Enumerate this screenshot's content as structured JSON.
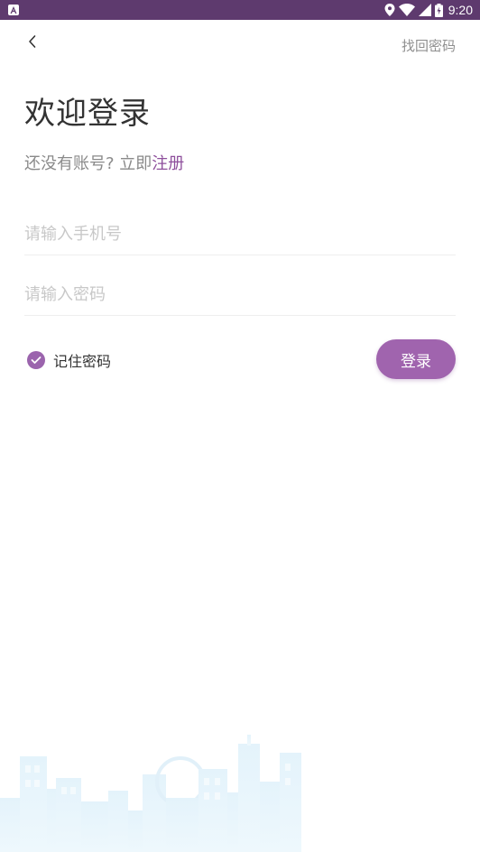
{
  "status_bar": {
    "time": "9:20",
    "color": "#5e3a6e"
  },
  "header": {
    "back_icon": "chevron-left-icon",
    "find_password": "找回密码"
  },
  "main": {
    "title": "欢迎登录",
    "register_prompt": "还没有账号? 立即",
    "register_link": "注册",
    "phone_placeholder": "请输入手机号",
    "password_placeholder": "请输入密码",
    "remember_label": "记住密码",
    "remember_checked": true,
    "login_label": "登录"
  },
  "colors": {
    "accent": "#a064ae",
    "link": "#8e4f9c",
    "status_bar": "#5e3a6e"
  }
}
